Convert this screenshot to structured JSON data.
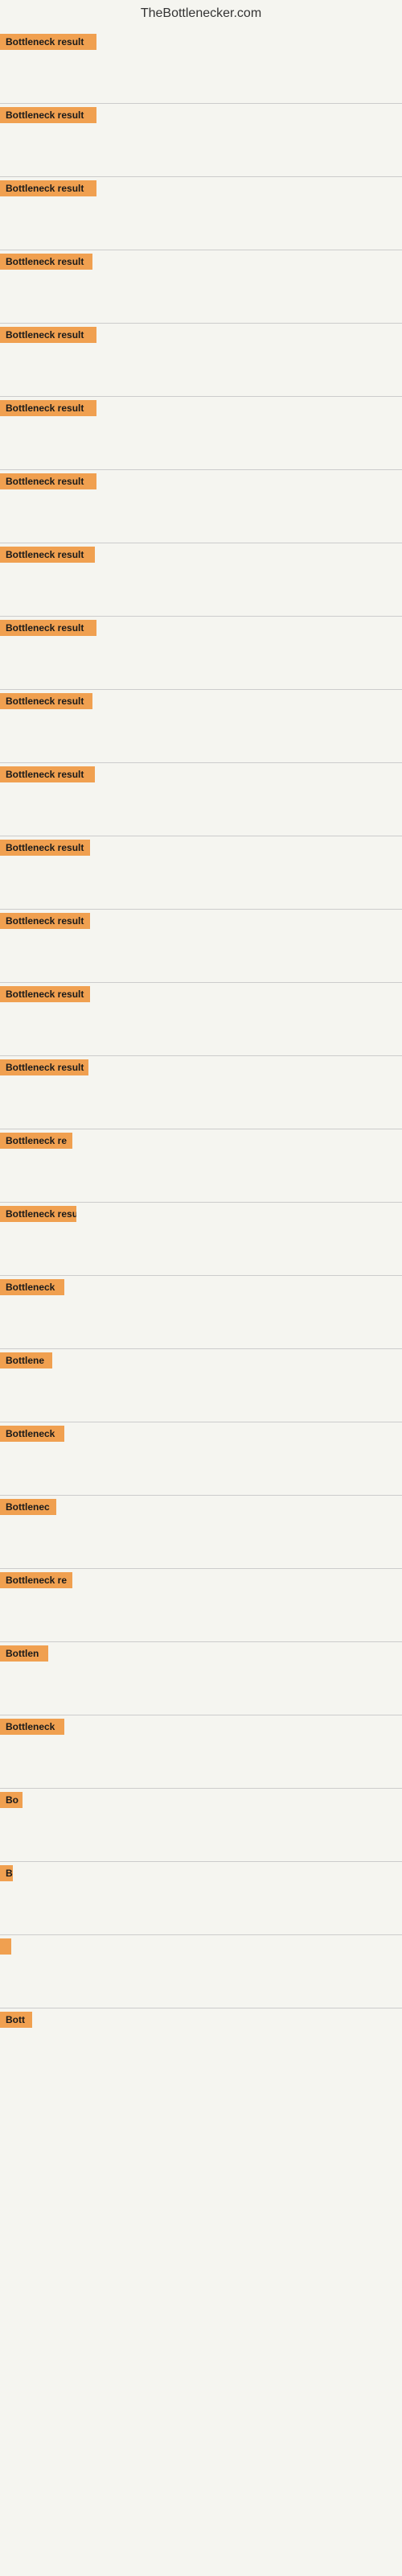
{
  "site": {
    "title": "TheBottlenecker.com"
  },
  "items": [
    {
      "id": 1,
      "label": "Bottleneck result"
    },
    {
      "id": 2,
      "label": "Bottleneck result"
    },
    {
      "id": 3,
      "label": "Bottleneck result"
    },
    {
      "id": 4,
      "label": "Bottleneck result"
    },
    {
      "id": 5,
      "label": "Bottleneck result"
    },
    {
      "id": 6,
      "label": "Bottleneck result"
    },
    {
      "id": 7,
      "label": "Bottleneck result"
    },
    {
      "id": 8,
      "label": "Bottleneck result"
    },
    {
      "id": 9,
      "label": "Bottleneck result"
    },
    {
      "id": 10,
      "label": "Bottleneck result"
    },
    {
      "id": 11,
      "label": "Bottleneck result"
    },
    {
      "id": 12,
      "label": "Bottleneck result"
    },
    {
      "id": 13,
      "label": "Bottleneck result"
    },
    {
      "id": 14,
      "label": "Bottleneck result"
    },
    {
      "id": 15,
      "label": "Bottleneck result"
    },
    {
      "id": 16,
      "label": "Bottleneck re"
    },
    {
      "id": 17,
      "label": "Bottleneck resul"
    },
    {
      "id": 18,
      "label": "Bottleneck"
    },
    {
      "id": 19,
      "label": "Bottlene"
    },
    {
      "id": 20,
      "label": "Bottleneck"
    },
    {
      "id": 21,
      "label": "Bottlenec"
    },
    {
      "id": 22,
      "label": "Bottleneck re"
    },
    {
      "id": 23,
      "label": "Bottlen"
    },
    {
      "id": 24,
      "label": "Bottleneck"
    },
    {
      "id": 25,
      "label": "Bo"
    },
    {
      "id": 26,
      "label": "B"
    },
    {
      "id": 27,
      "label": ""
    },
    {
      "id": 28,
      "label": "Bott"
    }
  ]
}
